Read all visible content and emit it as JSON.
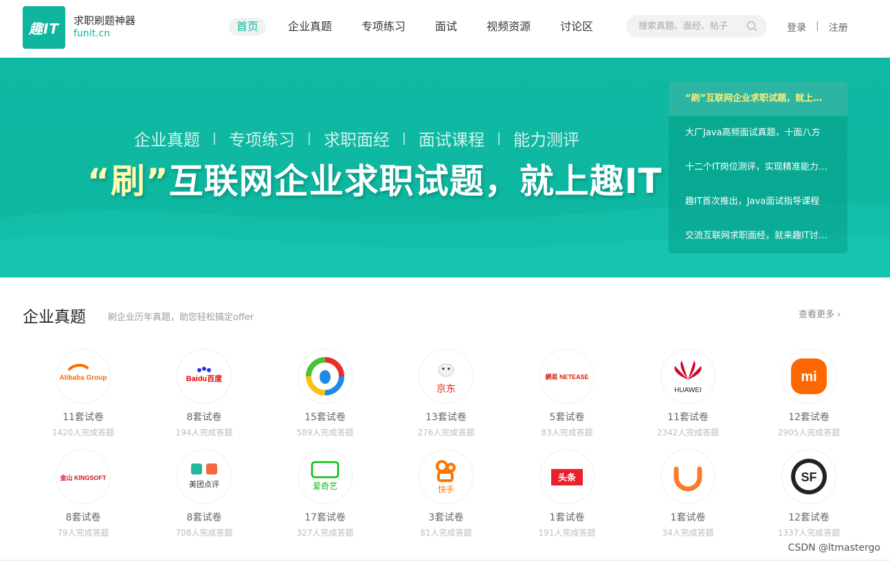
{
  "header": {
    "logo_text": "趣IT",
    "brand_name": "求职刷题神器",
    "brand_domain": "funit.cn",
    "nav": [
      {
        "label": "首页",
        "active": true
      },
      {
        "label": "企业真题",
        "active": false
      },
      {
        "label": "专项练习",
        "active": false
      },
      {
        "label": "面试",
        "active": false
      },
      {
        "label": "视频资源",
        "active": false
      },
      {
        "label": "讨论区",
        "active": false
      }
    ],
    "search_placeholder": "搜索真题、面经、帖子",
    "login": "登录",
    "separator": "|",
    "register": "注册"
  },
  "banner": {
    "categories": [
      "企业真题",
      "专项练习",
      "求职面经",
      "面试课程",
      "能力测评"
    ],
    "title_highlight": "“刷”",
    "title_rest": "互联网企业求职试题，就上趣IT",
    "news": [
      "“刷”互联网企业求职试题，就上趣IT",
      "大厂Java高频面试真题，十面八方",
      "十二个IT岗位测评，实现精准能力定位",
      "趣IT首次推出，Java面试指导课程",
      "交流互联网求职面经，就来趣IT讨论区"
    ]
  },
  "section": {
    "title": "企业真题",
    "subtitle": "刷企业历年真题，助您轻松搞定offer",
    "more": "查看更多"
  },
  "companies": [
    {
      "name": "Alibaba Group",
      "logo": "alibaba-logo",
      "sets": "11套试卷",
      "done": "1420人完成答题"
    },
    {
      "name": "Baidu百度",
      "logo": "baidu-logo",
      "sets": "8套试卷",
      "done": "194人完成答题"
    },
    {
      "name": "Tencent",
      "logo": "tencent-logo",
      "sets": "15套试卷",
      "done": "589人完成答题"
    },
    {
      "name": "京东",
      "logo": "jd-logo",
      "sets": "13套试卷",
      "done": "276人完成答题"
    },
    {
      "name": "網易 NETEASE",
      "logo": "netease-logo",
      "sets": "5套试卷",
      "done": "83人完成答题"
    },
    {
      "name": "HUAWEI",
      "logo": "huawei-logo",
      "sets": "11套试卷",
      "done": "2342人完成答题"
    },
    {
      "name": "mi",
      "logo": "xiaomi-logo",
      "sets": "12套试卷",
      "done": "2905人完成答题"
    },
    {
      "name": "金山 KINGSOFT",
      "logo": "kingsoft-logo",
      "sets": "8套试卷",
      "done": "79人完成答题"
    },
    {
      "name": "美团点评",
      "logo": "meituan-logo",
      "sets": "8套试卷",
      "done": "708人完成答题"
    },
    {
      "name": "爱奇艺",
      "logo": "iqiyi-logo",
      "sets": "17套试卷",
      "done": "327人完成答题"
    },
    {
      "name": "快手",
      "logo": "kuaishou-logo",
      "sets": "3套试卷",
      "done": "81人完成答题"
    },
    {
      "name": "头条",
      "logo": "toutiao-logo",
      "sets": "1套试卷",
      "done": "191人完成答题"
    },
    {
      "name": "DiDi",
      "logo": "didi-logo",
      "sets": "1套试卷",
      "done": "34人完成答题"
    },
    {
      "name": "SF",
      "logo": "sf-logo",
      "sets": "12套试卷",
      "done": "1337人完成答题"
    }
  ],
  "watermark": "CSDN @ltmastergo",
  "colors": {
    "brand": "#0fb59e",
    "highlight": "#ffef7a"
  }
}
